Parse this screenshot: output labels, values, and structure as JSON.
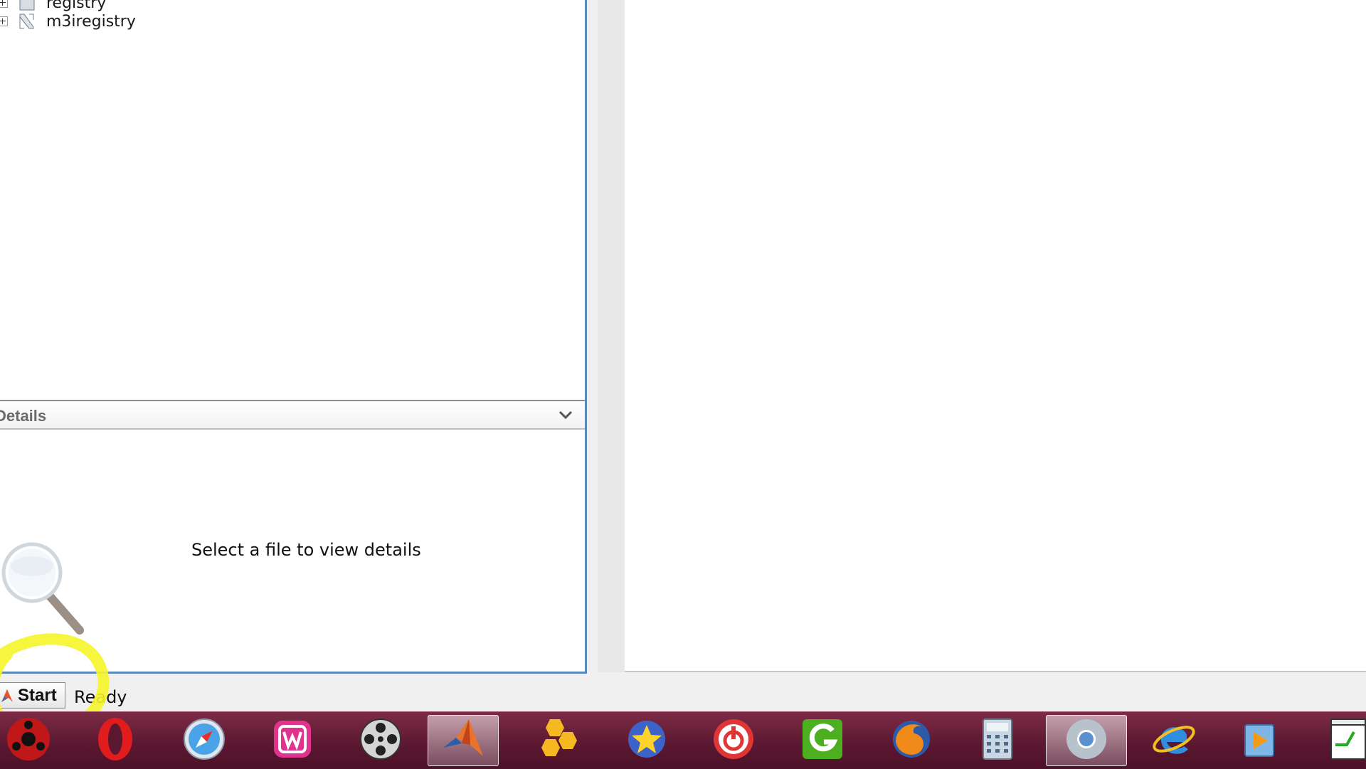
{
  "folder_tree": {
    "items": [
      {
        "label": "registry"
      },
      {
        "label": "m3iregistry"
      }
    ]
  },
  "details": {
    "title": "Details",
    "empty_message": "Select a file to view details"
  },
  "status_bar": {
    "start_label": "Start",
    "status": "Ready"
  },
  "taskbar": {
    "items": [
      {
        "icon": "sharingan-icon"
      },
      {
        "icon": "opera-icon"
      },
      {
        "icon": "safari-icon"
      },
      {
        "icon": "wamp-icon"
      },
      {
        "icon": "film-reel-icon"
      },
      {
        "icon": "matlab-icon",
        "active": true
      },
      {
        "icon": "honeycomb-icon"
      },
      {
        "icon": "star-icon"
      },
      {
        "icon": "power-icon"
      },
      {
        "icon": "grammarly-icon"
      },
      {
        "icon": "firefox-icon"
      },
      {
        "icon": "calculator-icon"
      },
      {
        "icon": "chrome-icon",
        "active": true
      },
      {
        "icon": "internet-explorer-icon"
      },
      {
        "icon": "media-player-icon"
      },
      {
        "icon": "notepad-plus-plus-icon"
      }
    ]
  },
  "colors": {
    "panel_border": "#5b87b9",
    "taskbar": "#5a1730",
    "annotation": "#f5f52a"
  }
}
